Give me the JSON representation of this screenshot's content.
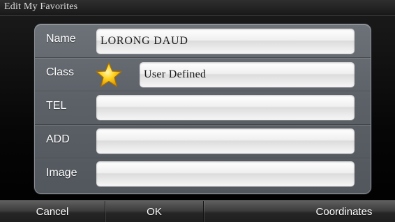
{
  "window": {
    "title": "Edit My Favorites"
  },
  "form": {
    "name": {
      "label": "Name",
      "value": "LORONG DAUD"
    },
    "class": {
      "label": "Class",
      "value": "User Defined",
      "icon": "star-icon"
    },
    "tel": {
      "label": "TEL",
      "value": ""
    },
    "add": {
      "label": "ADD",
      "value": ""
    },
    "image": {
      "label": "Image",
      "value": ""
    }
  },
  "toolbar": {
    "cancel_label": "Cancel",
    "ok_label": "OK",
    "coordinates_label": "Coordinates"
  },
  "colors": {
    "panel": "#5f646b",
    "field": "#f0f0f0",
    "star": "#f5c400"
  }
}
